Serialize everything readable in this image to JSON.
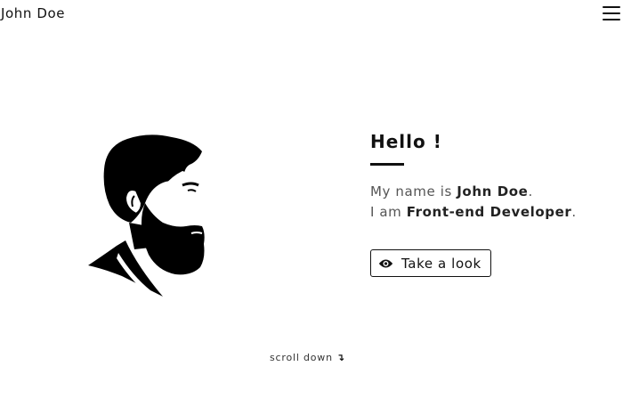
{
  "header": {
    "brand": "John Doe",
    "menu_icon": "hamburger-menu-icon"
  },
  "portrait": {
    "icon": "bearded-man-profile-icon"
  },
  "intro": {
    "greeting": "Hello !",
    "line1_prefix": "My name is ",
    "line1_name": "John Doe",
    "line1_suffix": ".",
    "line2_prefix": "I am ",
    "line2_role": "Front-end Developer",
    "line2_suffix": ".",
    "cta_label": "Take a look",
    "cta_icon": "eye-icon"
  },
  "footer": {
    "scroll_label": "scroll down",
    "scroll_arrow": "↴"
  },
  "colors": {
    "text": "#111111",
    "muted": "#555555",
    "background": "#ffffff"
  }
}
